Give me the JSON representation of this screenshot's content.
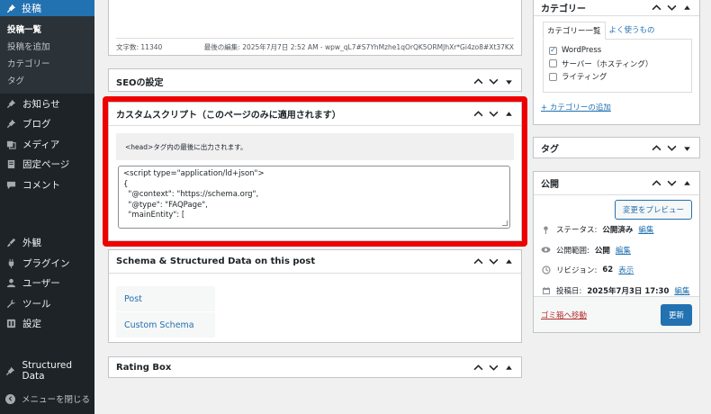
{
  "sidebar": {
    "header_label": "投稿",
    "sub_items": [
      "投稿一覧",
      "投稿を追加",
      "カテゴリー",
      "タグ"
    ],
    "items_top": [
      "お知らせ",
      "ブログ",
      "メディア",
      "固定ページ",
      "コメント"
    ],
    "items_mid": [
      "外観",
      "プラグイン",
      "ユーザー",
      "ツール",
      "設定"
    ],
    "structured_data": "Structured Data",
    "collapse": "メニューを閉じる"
  },
  "editor": {
    "word_count": "文字数: 11340",
    "last_edit": "最後の編集: 2025年7月7日 2:52 AM - wpw_qL7#S7YhMzhe1qOrQK5ORMJhXr*Gi4zo8#Xt37KX"
  },
  "seo": {
    "title": "SEOの設定"
  },
  "custom_script": {
    "title": "カスタムスクリプト（このページのみに適用されます）",
    "notice": "<head>タグ内の最後に出力されます。",
    "code_lines": [
      "<script type=\"application/ld+json\">",
      "{",
      "  \"@context\": \"https://schema.org\",",
      "  \"@type\": \"FAQPage\",",
      "  \"mainEntity\": ["
    ]
  },
  "schema": {
    "title": "Schema & Structured Data on this post",
    "tabs": [
      "Post",
      "Custom Schema"
    ]
  },
  "rating": {
    "title": "Rating Box"
  },
  "categories": {
    "title": "カテゴリー",
    "tab_all": "カテゴリー一覧",
    "tab_popular": "よく使うもの",
    "items": [
      {
        "label": "WordPress",
        "checked": true
      },
      {
        "label": "サーバー（ホスティング）",
        "checked": false
      },
      {
        "label": "ライティング",
        "checked": false
      }
    ],
    "add_link": "+ カテゴリーの追加"
  },
  "tags": {
    "title": "タグ"
  },
  "publish": {
    "title": "公開",
    "preview_btn": "変更をプレビュー",
    "status_label": "ステータス:",
    "status_value": "公開済み",
    "visibility_label": "公開範囲:",
    "visibility_value": "公開",
    "revisions_label": "リビジョン:",
    "revisions_value": "62",
    "revisions_link": "表示",
    "date_label": "投稿日:",
    "date_value": "2025年7月3日 17:30",
    "edit_link": "編集",
    "trash": "ゴミ箱へ移動",
    "update_btn": "更新"
  },
  "colors": {
    "accent": "#2271b1",
    "highlight": "#ee0000",
    "sidebar": "#1d2327"
  }
}
